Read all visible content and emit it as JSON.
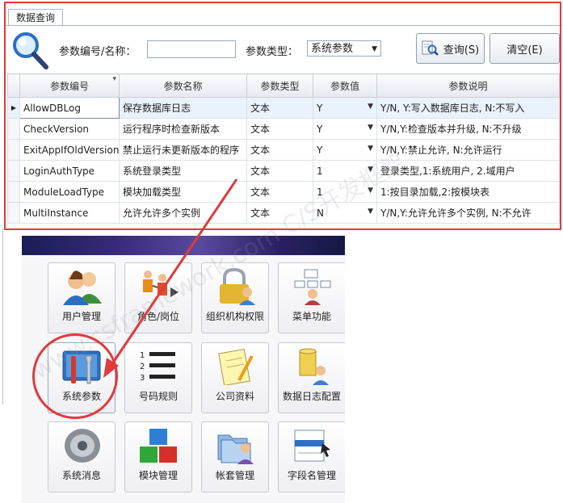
{
  "tab": {
    "label": "数据查询"
  },
  "search": {
    "code_label": "参数编号/名称：",
    "code_value": "",
    "type_label": "参数类型：",
    "type_value": "系统参数",
    "query_button": "查询(S)",
    "clear_button": "清空(E)"
  },
  "grid": {
    "columns": [
      "参数编号",
      "参数名称",
      "参数类型",
      "参数值",
      "参数说明"
    ],
    "rows": [
      {
        "code": "AllowDBLog",
        "name": "保存数据库日志",
        "type": "文本",
        "value": "Y",
        "desc": "Y/N, Y:写入数据库日志, N:不写入"
      },
      {
        "code": "CheckVersion",
        "name": "运行程序时检查新版本",
        "type": "文本",
        "value": "Y",
        "desc": "Y/N,Y:检查版本并升级, N:不升级"
      },
      {
        "code": "ExitAppIfOldVersion",
        "name": "禁止运行未更新版本的程序",
        "type": "文本",
        "value": "Y",
        "desc": "Y/N,Y:禁止允许, N:允许运行"
      },
      {
        "code": "LoginAuthType",
        "name": "系统登录类型",
        "type": "文本",
        "value": "1",
        "desc": "登录类型,1:系统用户, 2.域用户"
      },
      {
        "code": "ModuleLoadType",
        "name": "模块加载类型",
        "type": "文本",
        "value": "1",
        "desc": "1:按目录加载,2:按模块表"
      },
      {
        "code": "MultiInstance",
        "name": "允许允许多个实例",
        "type": "文本",
        "value": "N",
        "desc": "Y/N,Y:允许允许多个实例, N:不允许"
      }
    ]
  },
  "modules": {
    "tiles": [
      {
        "label": "用户管理",
        "icon": "users-icon"
      },
      {
        "label": "角色/岗位",
        "icon": "roles-icon"
      },
      {
        "label": "组织机构权限",
        "icon": "org-lock-icon"
      },
      {
        "label": "菜单功能",
        "icon": "menu-icon"
      },
      {
        "label": "系统参数",
        "icon": "tools-icon"
      },
      {
        "label": "号码规则",
        "icon": "numbered-list-icon"
      },
      {
        "label": "公司资料",
        "icon": "notepad-icon"
      },
      {
        "label": "数据日志配置",
        "icon": "database-icon"
      },
      {
        "label": "系统消息",
        "icon": "speaker-icon"
      },
      {
        "label": "模块管理",
        "icon": "cubes-icon"
      },
      {
        "label": "帐套管理",
        "icon": "folders-icon"
      },
      {
        "label": "字段名管理",
        "icon": "field-icon"
      }
    ]
  },
  "watermark": "www.csframework.com C/S开发框架",
  "colors": {
    "highlight": "#e03a3a",
    "selected_row": "#e9f2fd"
  }
}
